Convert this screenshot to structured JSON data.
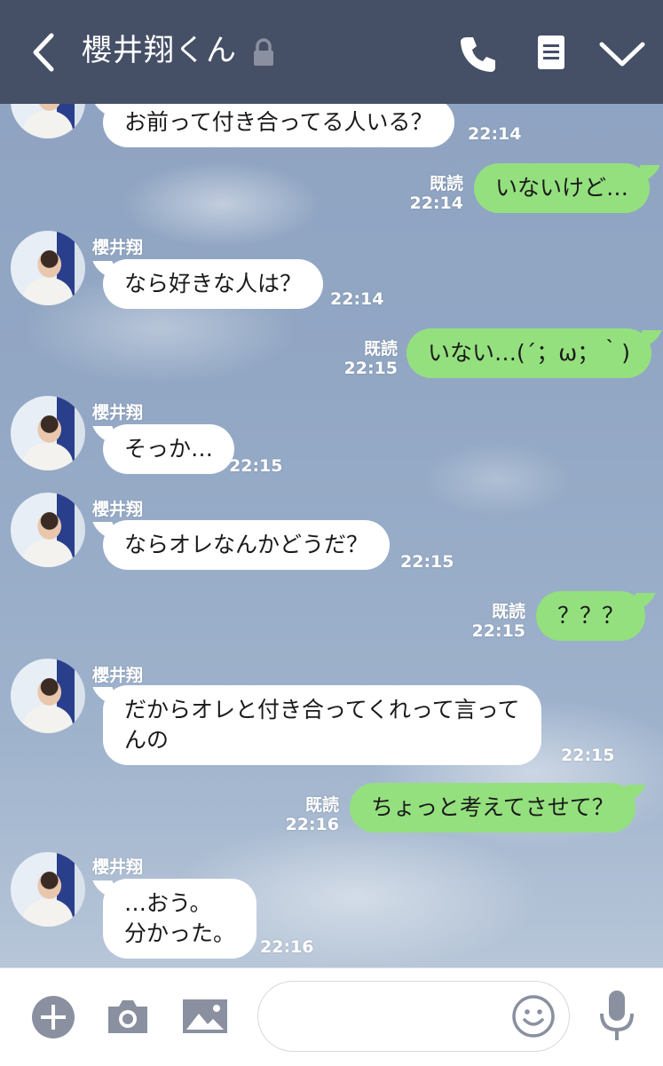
{
  "header": {
    "title": "櫻井翔くん",
    "bg_color": "#454f66"
  },
  "colors": {
    "outgoing_bubble": "#94e07e",
    "incoming_bubble": "#ffffff",
    "icon_gray": "#8a90a0"
  },
  "messages": [
    {
      "dir": "in",
      "sender": "",
      "text": "お前って付き合ってる人いる？",
      "time": "22:14"
    },
    {
      "dir": "out",
      "read": "既読",
      "text": "いないけど…",
      "time": "22:14"
    },
    {
      "dir": "in",
      "sender": "櫻井翔",
      "text": "なら好きな人は？",
      "time": "22:14"
    },
    {
      "dir": "out",
      "read": "既読",
      "text": "いない…(´；ω；｀)",
      "time": "22:15"
    },
    {
      "dir": "in",
      "sender": "櫻井翔",
      "text": "そっか…",
      "time": "22:15"
    },
    {
      "dir": "in",
      "sender": "櫻井翔",
      "text": "ならオレなんかどうだ？",
      "time": "22:15"
    },
    {
      "dir": "out",
      "read": "既読",
      "text": "？？？",
      "time": "22:15"
    },
    {
      "dir": "in",
      "sender": "櫻井翔",
      "text_lines": [
        "だからオレと付き合ってくれって言って",
        "んの"
      ],
      "time": "22:15"
    },
    {
      "dir": "out",
      "read": "既読",
      "text": "ちょっと考えてさせて？",
      "time": "22:16"
    },
    {
      "dir": "in",
      "sender": "櫻井翔",
      "text_lines": [
        "…おう。",
        "分かった。"
      ],
      "time": "22:16"
    }
  ],
  "input": {
    "placeholder": "",
    "value": ""
  }
}
